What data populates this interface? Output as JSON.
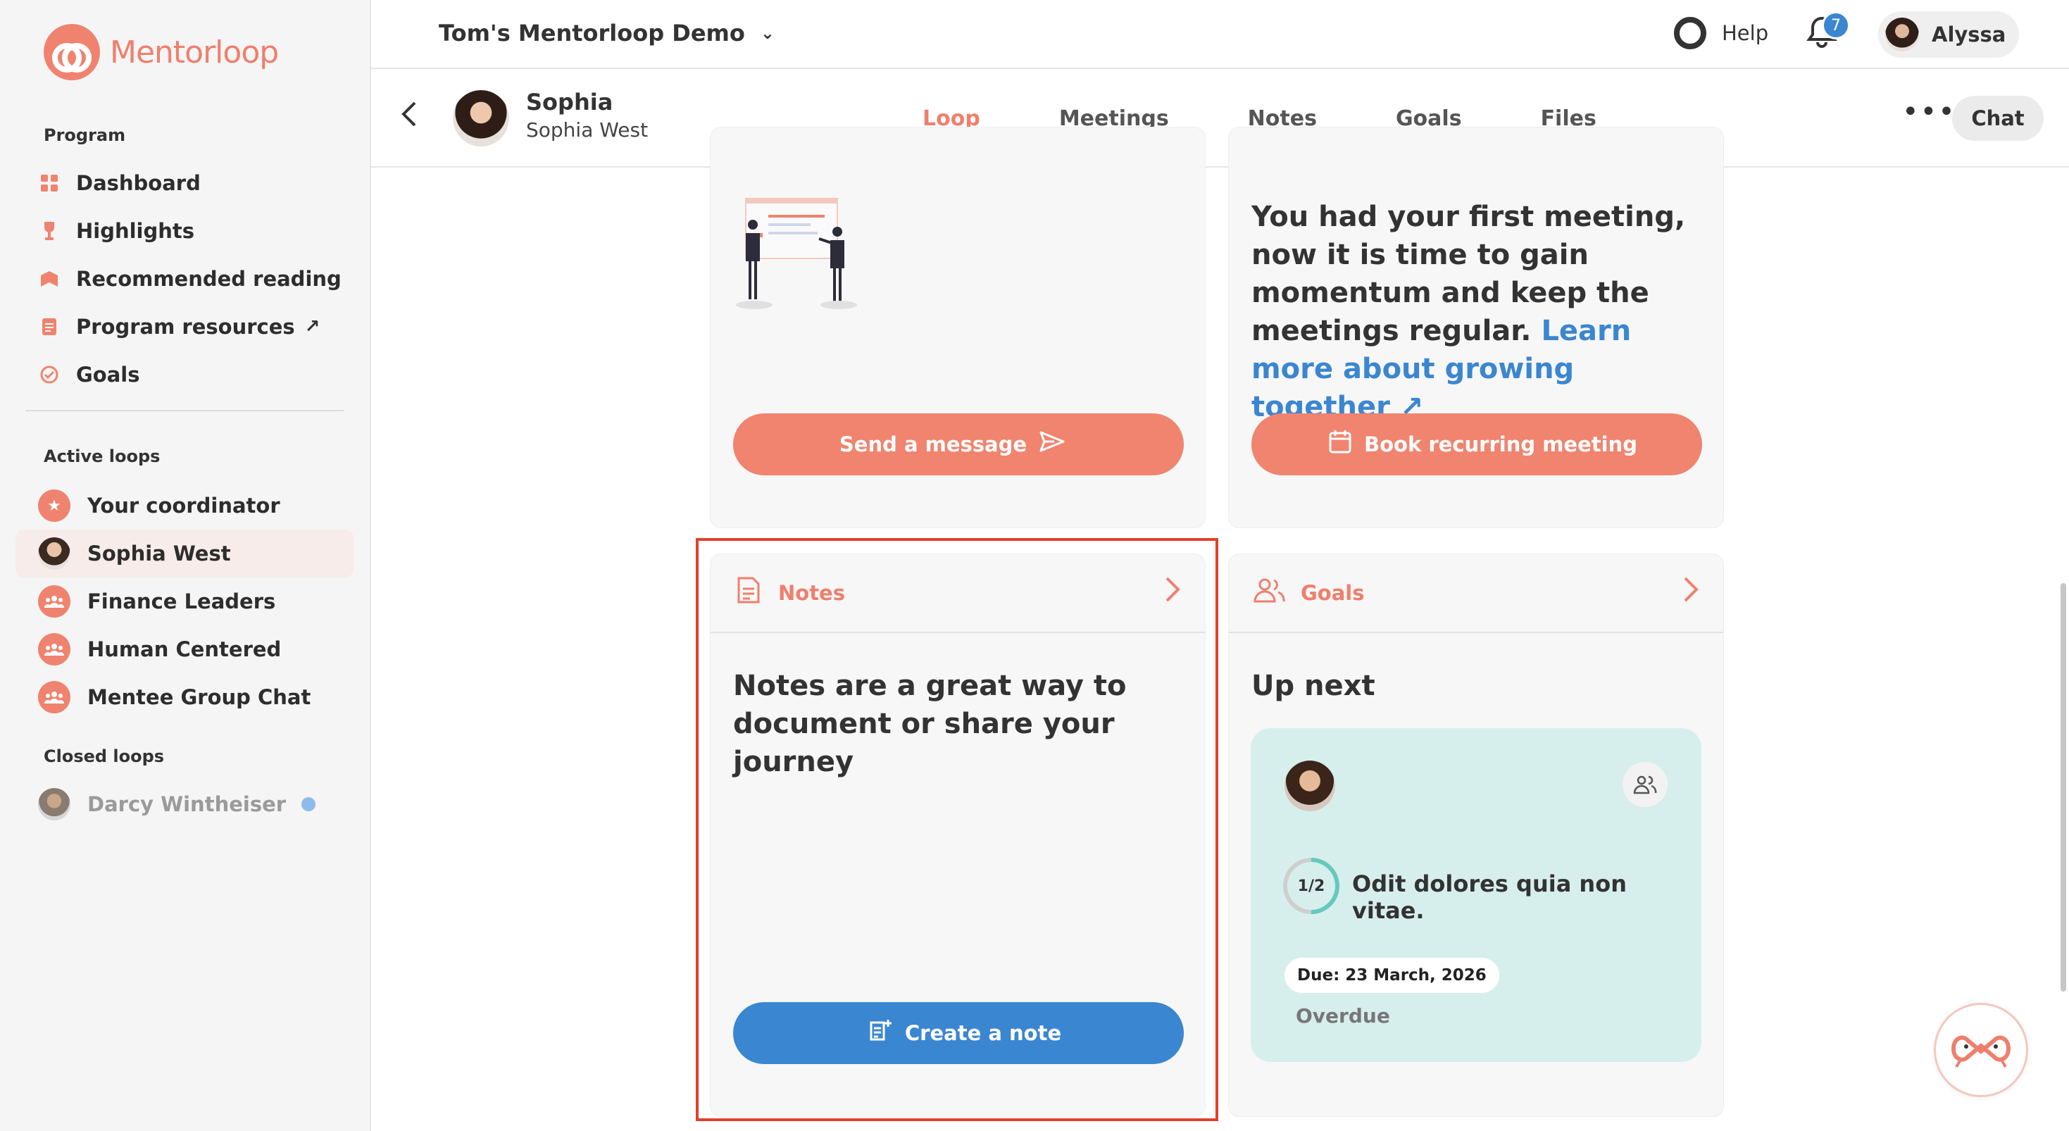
{
  "brand": {
    "name": "Mentorloop",
    "color": "#f0836f"
  },
  "sidebar": {
    "program_label": "Program",
    "program_items": [
      {
        "label": "Dashboard",
        "icon": "dashboard-icon"
      },
      {
        "label": "Highlights",
        "icon": "trophy-icon"
      },
      {
        "label": "Recommended reading",
        "icon": "book-icon"
      },
      {
        "label": "Program resources",
        "icon": "document-icon",
        "external": true
      },
      {
        "label": "Goals",
        "icon": "goal-check-icon"
      }
    ],
    "active_loops_label": "Active loops",
    "active_loops": [
      {
        "label": "Your coordinator",
        "icon": "star-icon"
      },
      {
        "label": "Sophia West",
        "icon": "avatar",
        "active": true
      },
      {
        "label": "Finance Leaders",
        "icon": "group-icon"
      },
      {
        "label": "Human Centered",
        "icon": "group-icon"
      },
      {
        "label": "Mentee Group Chat",
        "icon": "group-icon"
      }
    ],
    "closed_loops_label": "Closed loops",
    "closed_loops": [
      {
        "label": "Darcy Wintheiser",
        "icon": "avatar",
        "unread": true
      }
    ]
  },
  "topbar": {
    "workspace": "Tom's Mentorloop Demo",
    "help_label": "Help",
    "notification_count": "7",
    "user_name": "Alyssa"
  },
  "profile": {
    "first_name": "Sophia",
    "full_name": "Sophia West"
  },
  "tabs": [
    {
      "label": "Loop",
      "active": true
    },
    {
      "label": "Meetings"
    },
    {
      "label": "Notes"
    },
    {
      "label": "Goals"
    },
    {
      "label": "Files"
    }
  ],
  "actions": {
    "chat_label": "Chat"
  },
  "cards": {
    "message": {
      "button": "Send a message"
    },
    "meeting": {
      "text": "You had your first meeting, now it is time to gain momentum and keep the meetings regular.",
      "link": "Learn more about growing together",
      "button": "Book recurring meeting"
    },
    "notes": {
      "title": "Notes",
      "text": "Notes are a great way to document or share your journey",
      "button": "Create a note"
    },
    "goals": {
      "title": "Goals",
      "up_next_label": "Up next",
      "goal": {
        "progress": "1/2",
        "progress_fraction": 0.5,
        "title": "Odit dolores quia non vitae.",
        "due": "Due: 23 March, 2026",
        "status": "Overdue"
      }
    }
  },
  "colors": {
    "accent": "#ef7f6c",
    "link": "#3b86d0",
    "goal_card_bg": "#d7efec",
    "highlight": "#e0412d"
  }
}
